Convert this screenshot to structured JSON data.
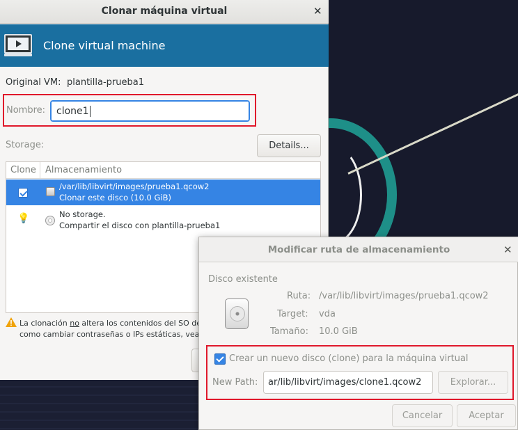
{
  "main_window": {
    "title": "Clonar máquina virtual",
    "banner_title": "Clone virtual machine",
    "original_vm_label": "Original VM:",
    "original_vm_value": "plantilla-prueba1",
    "name_label": "Nombre:",
    "name_value": "clone1",
    "storage_label": "Storage:",
    "details_button": "Details...",
    "table": {
      "columns": [
        "Clone",
        "Almacenamiento"
      ],
      "rows": [
        {
          "line1": "/var/lib/libvirt/images/prueba1.qcow2",
          "line2": "Clonar este disco (10.0 GiB)",
          "checked": true,
          "selected": true,
          "icon": "disk-icon"
        },
        {
          "line1": "No storage.",
          "line2": "Compartir el disco con plantilla-prueba1",
          "checked": false,
          "selected": false,
          "icon": "cdrom-icon"
        }
      ]
    },
    "warning_pre": "La clonación ",
    "warning_underlined": "no",
    "warning_post": " altera los contenidos del SO del",
    "warning_line2": "como cambiar contraseñas o IPs estáticas, vea l"
  },
  "dialog": {
    "title": "Modificar ruta de almacenamiento",
    "section_title": "Disco existente",
    "ruta_label": "Ruta:",
    "ruta_value": "/var/lib/libvirt/images/prueba1.qcow2",
    "target_label": "Target:",
    "target_value": "vda",
    "size_label": "Tamaño:",
    "size_value": "10.0 GiB",
    "create_checkbox_label": "Crear un nuevo disco (clone) para la máquina virtual",
    "create_checked": true,
    "new_path_label": "New Path:",
    "new_path_value": "ar/lib/libvirt/images/clone1.qcow2",
    "browse_button": "Explorar...",
    "cancel_button": "Cancelar",
    "accept_button": "Aceptar"
  },
  "colors": {
    "banner": "#1a6fa0",
    "selection": "#3584e4",
    "highlight_box": "#e0182b"
  }
}
